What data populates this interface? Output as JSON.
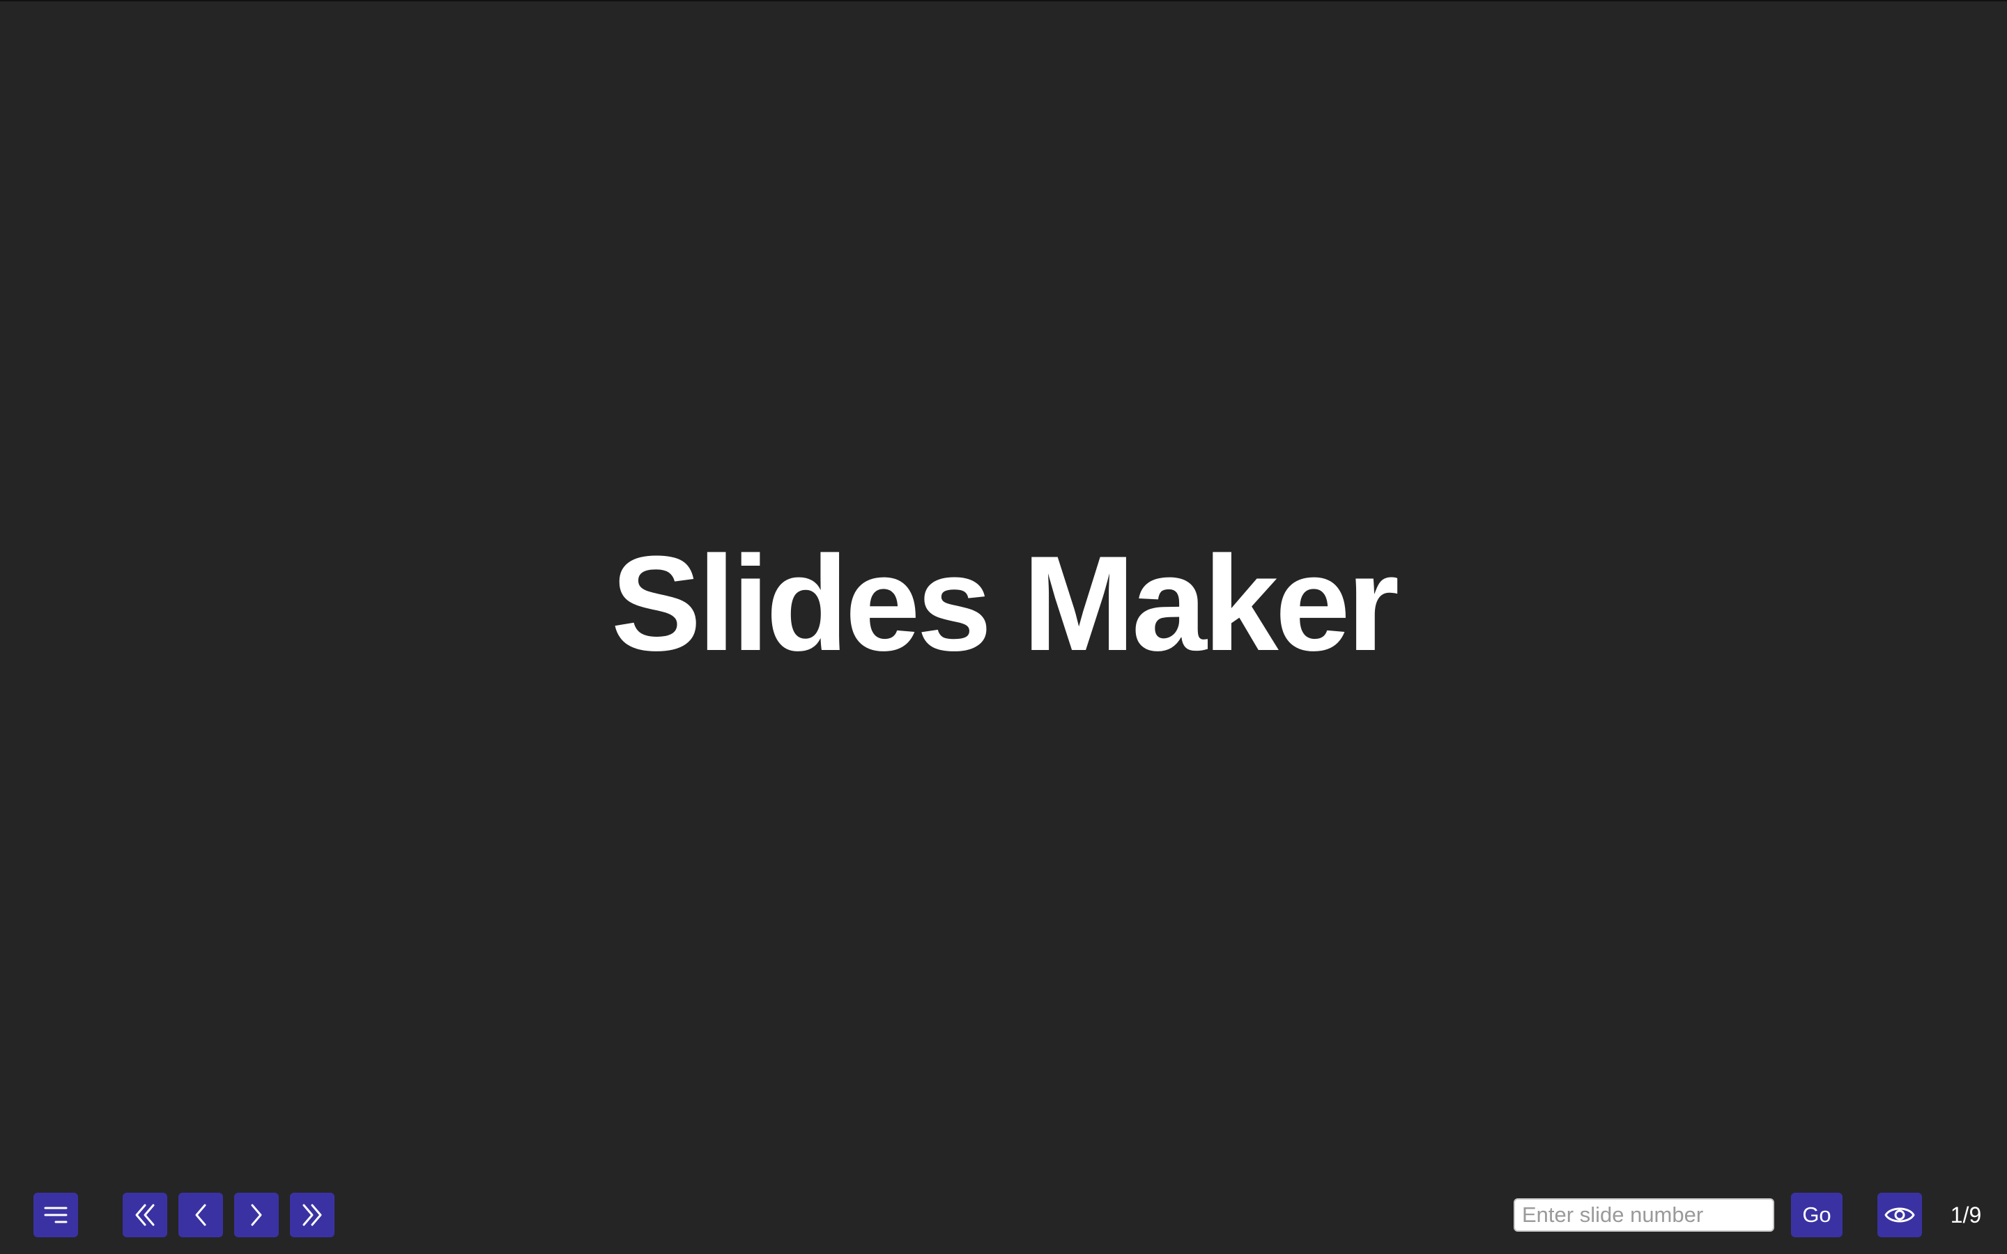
{
  "slide": {
    "title": "Slides Maker"
  },
  "controls": {
    "menu_icon": "menu-icon",
    "first_icon": "double-chevron-left-icon",
    "prev_icon": "chevron-left-icon",
    "next_icon": "chevron-right-icon",
    "last_icon": "double-chevron-right-icon",
    "view_icon": "eye-icon",
    "slide_input_placeholder": "Enter slide number",
    "slide_input_value": "",
    "go_label": "Go",
    "page_counter": "1/9"
  },
  "colors": {
    "background": "#252525",
    "button": "#3a32a3",
    "text": "#ffffff"
  }
}
